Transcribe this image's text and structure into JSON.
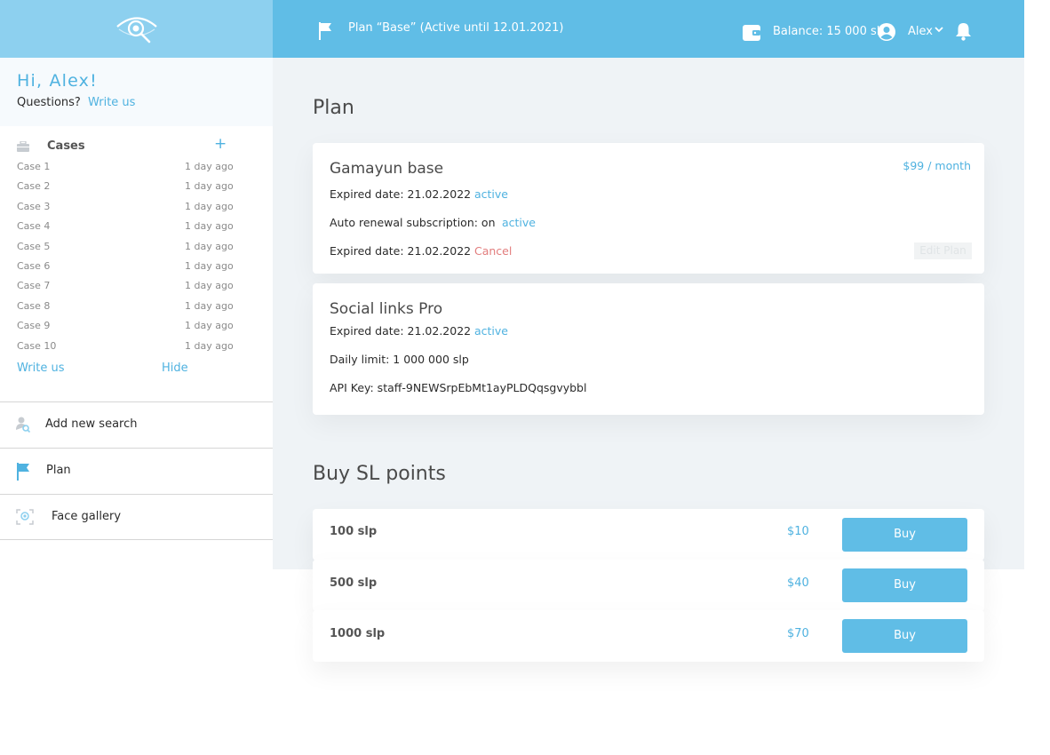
{
  "topbar": {
    "plan_text": "Plan “Base” (Active until 12.01.2021)",
    "balance": "Balance: 15 000 slp",
    "user": "Alex"
  },
  "sidebar": {
    "greeting": "Hi, Alex!",
    "questions": "Questions?",
    "write_us": "Write us",
    "cases_label": "Cases",
    "add_symbol": "+",
    "cases": [
      {
        "name": "Case 1",
        "time": "1 day ago"
      },
      {
        "name": "Case 2",
        "time": "1 day ago"
      },
      {
        "name": "Case 3",
        "time": "1 day ago"
      },
      {
        "name": "Case 4",
        "time": "1 day ago"
      },
      {
        "name": "Case 5",
        "time": "1 day ago"
      },
      {
        "name": "Case 6",
        "time": "1 day ago"
      },
      {
        "name": "Case 7",
        "time": "1 day ago"
      },
      {
        "name": "Case 8",
        "time": "1 day ago"
      },
      {
        "name": "Case 9",
        "time": "1 day ago"
      },
      {
        "name": "Case 10",
        "time": "1 day ago"
      }
    ],
    "write_us_bottom": "Write us",
    "hide": "Hide",
    "nav": [
      {
        "label": "Add new search",
        "icon": "person-search-icon"
      },
      {
        "label": "Plan",
        "icon": "flag-icon"
      },
      {
        "label": "Face gallery",
        "icon": "face-scan-icon"
      }
    ]
  },
  "main": {
    "plan_heading": "Plan",
    "plans": [
      {
        "title": "Gamayun base",
        "price": "$99 / month",
        "rows": [
          {
            "text": "Expired date: 21.02.2022",
            "status": "active"
          },
          {
            "text": "Auto renewal subscription: on",
            "status": "active"
          },
          {
            "text": "Expired date: 21.02.2022",
            "status": "Cancel"
          }
        ],
        "edit": "Edit Plan"
      },
      {
        "title": "Social links Pro",
        "rows": [
          {
            "text": "Expired date: 21.02.2022",
            "status": "active"
          },
          {
            "text": "Daily limit: 1 000 000 slp"
          },
          {
            "text": "API Key: staff-9NEWSrpEbMt1ayPLDQqsgvybbl"
          }
        ]
      }
    ],
    "buy_heading": "Buy SL points",
    "packages": [
      {
        "amount": "100 slp",
        "price": "$10",
        "button": "Buy"
      },
      {
        "amount": "500 slp",
        "price": "$40",
        "button": "Buy"
      },
      {
        "amount": "1000 slp",
        "price": "$70",
        "button": "Buy"
      }
    ]
  },
  "colors": {
    "accent": "#60bde6",
    "logo_bar": "#8dd0ef",
    "link": "#4fb2e0",
    "danger": "#e27d7d",
    "main_bg": "#eff3f6"
  }
}
